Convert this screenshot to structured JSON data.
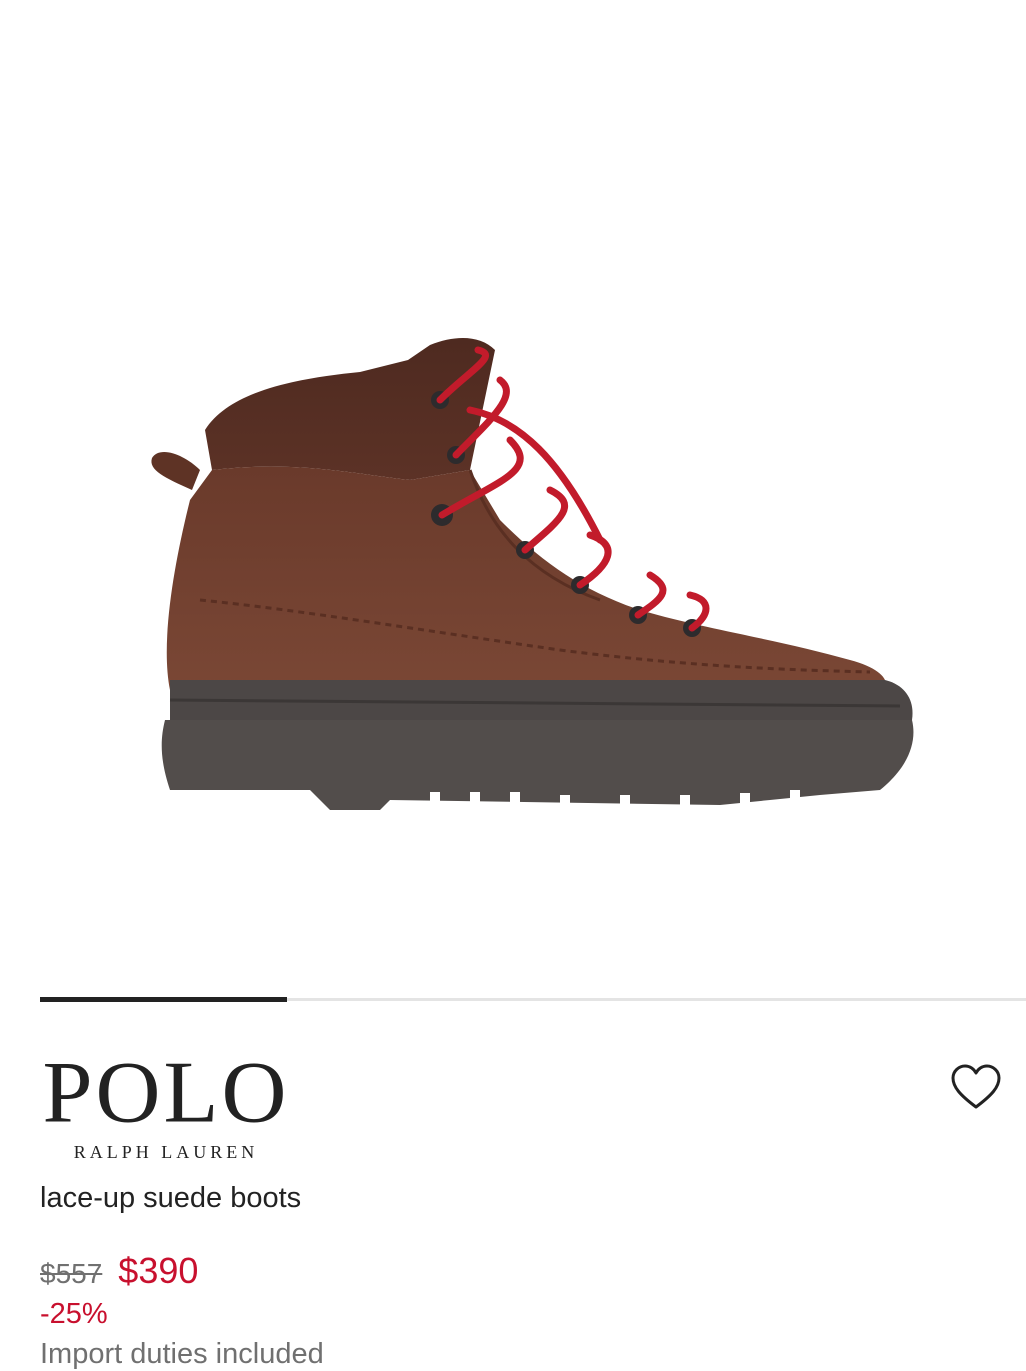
{
  "product": {
    "image_alt": "Brown suede hiking boot with red laces",
    "brand_main": "POLO",
    "brand_sub": "RALPH LAUREN",
    "name": "lace-up suede boots",
    "price_original": "$557",
    "price_sale": "$390",
    "discount": "-25%",
    "duties_note": "Import duties included"
  },
  "gallery": {
    "progress": 0.25
  },
  "icons": {
    "wishlist": "heart-outline-icon"
  },
  "colors": {
    "sale": "#c8102e",
    "muted": "#707070",
    "text": "#222222",
    "suede": "#6e3d2d",
    "laces": "#c21b2b",
    "sole": "#4a4543"
  }
}
